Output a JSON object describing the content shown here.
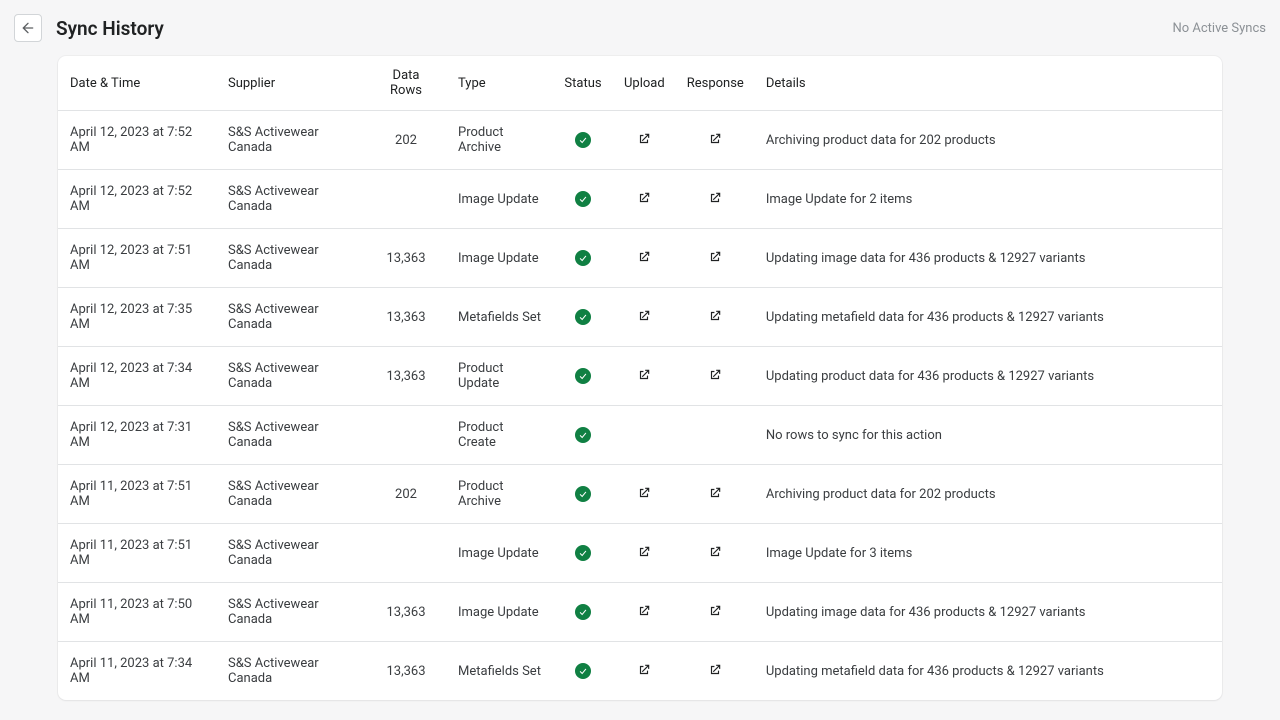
{
  "header": {
    "title": "Sync History",
    "status": "No Active Syncs"
  },
  "table": {
    "columns": {
      "datetime": "Date & Time",
      "supplier": "Supplier",
      "rows": "Data Rows",
      "type": "Type",
      "status": "Status",
      "upload": "Upload",
      "response": "Response",
      "details": "Details"
    },
    "rows": [
      {
        "datetime": "April 12, 2023 at 7:52 AM",
        "supplier": "S&S Activewear Canada",
        "rows": "202",
        "type": "Product Archive",
        "status": "success",
        "upload": true,
        "response": true,
        "details": "Archiving product data for 202 products"
      },
      {
        "datetime": "April 12, 2023 at 7:52 AM",
        "supplier": "S&S Activewear Canada",
        "rows": "",
        "type": "Image Update",
        "status": "success",
        "upload": true,
        "response": true,
        "details": "Image Update for 2 items"
      },
      {
        "datetime": "April 12, 2023 at 7:51 AM",
        "supplier": "S&S Activewear Canada",
        "rows": "13,363",
        "type": "Image Update",
        "status": "success",
        "upload": true,
        "response": true,
        "details": "Updating image data for 436 products & 12927 variants"
      },
      {
        "datetime": "April 12, 2023 at 7:35 AM",
        "supplier": "S&S Activewear Canada",
        "rows": "13,363",
        "type": "Metafields Set",
        "status": "success",
        "upload": true,
        "response": true,
        "details": "Updating metafield data for 436 products & 12927 variants"
      },
      {
        "datetime": "April 12, 2023 at 7:34 AM",
        "supplier": "S&S Activewear Canada",
        "rows": "13,363",
        "type": "Product Update",
        "status": "success",
        "upload": true,
        "response": true,
        "details": "Updating product data for 436 products & 12927 variants"
      },
      {
        "datetime": "April 12, 2023 at 7:31 AM",
        "supplier": "S&S Activewear Canada",
        "rows": "",
        "type": "Product Create",
        "status": "success",
        "upload": false,
        "response": false,
        "details": "No rows to sync for this action"
      },
      {
        "datetime": "April 11, 2023 at 7:51 AM",
        "supplier": "S&S Activewear Canada",
        "rows": "202",
        "type": "Product Archive",
        "status": "success",
        "upload": true,
        "response": true,
        "details": "Archiving product data for 202 products"
      },
      {
        "datetime": "April 11, 2023 at 7:51 AM",
        "supplier": "S&S Activewear Canada",
        "rows": "",
        "type": "Image Update",
        "status": "success",
        "upload": true,
        "response": true,
        "details": "Image Update for 3 items"
      },
      {
        "datetime": "April 11, 2023 at 7:50 AM",
        "supplier": "S&S Activewear Canada",
        "rows": "13,363",
        "type": "Image Update",
        "status": "success",
        "upload": true,
        "response": true,
        "details": "Updating image data for 436 products & 12927 variants"
      },
      {
        "datetime": "April 11, 2023 at 7:34 AM",
        "supplier": "S&S Activewear Canada",
        "rows": "13,363",
        "type": "Metafields Set",
        "status": "success",
        "upload": true,
        "response": true,
        "details": "Updating metafield data for 436 products & 12927 variants"
      }
    ]
  }
}
